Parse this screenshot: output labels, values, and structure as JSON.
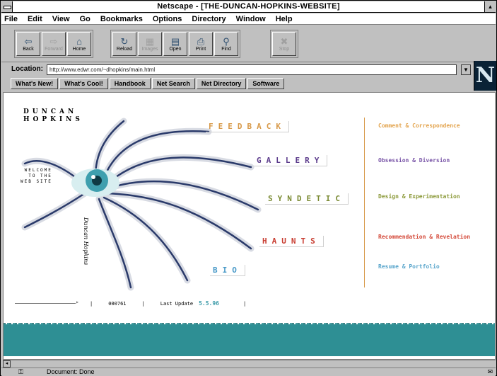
{
  "window": {
    "title": "Netscape - [THE-DUNCAN-HOPKINS-WEBSITE]",
    "maximize_glyph": "▴"
  },
  "menu": [
    "File",
    "Edit",
    "View",
    "Go",
    "Bookmarks",
    "Options",
    "Directory",
    "Window",
    "Help"
  ],
  "toolbar": {
    "nav_group": [
      {
        "label": "Back",
        "icon": "back-arrow-icon",
        "glyph": "⇦",
        "enabled": true
      },
      {
        "label": "Forward",
        "icon": "forward-arrow-icon",
        "glyph": "⇨",
        "enabled": false
      },
      {
        "label": "Home",
        "icon": "home-icon",
        "glyph": "⌂",
        "enabled": true
      }
    ],
    "load_group": [
      {
        "label": "Reload",
        "icon": "reload-icon",
        "glyph": "↻",
        "enabled": true
      },
      {
        "label": "Images",
        "icon": "images-icon",
        "glyph": "▦",
        "enabled": false
      },
      {
        "label": "Open",
        "icon": "open-icon",
        "glyph": "▤",
        "enabled": true
      },
      {
        "label": "Print",
        "icon": "print-icon",
        "glyph": "⎙",
        "enabled": true
      },
      {
        "label": "Find",
        "icon": "find-icon",
        "glyph": "⚲",
        "enabled": true
      }
    ],
    "stop_group": [
      {
        "label": "Stop",
        "icon": "stop-icon",
        "glyph": "✖",
        "enabled": false
      }
    ]
  },
  "location": {
    "label": "Location:",
    "url": "http://www.edwr.com/~dhopkins/main.html",
    "dropdown_glyph": "▼"
  },
  "directory_buttons": [
    "What's New!",
    "What's Cool!",
    "Handbook",
    "Net Search",
    "Net Directory",
    "Software"
  ],
  "logo_letter": "N",
  "page": {
    "brand": "DUNCAN\nHOPKINS",
    "welcome": "WELCOME\nTO THE\nWEB SITE",
    "signature": "Duncan Hopkins",
    "nav": [
      {
        "word": "FEEDBACK",
        "desc": "Comment & Correspondence",
        "color": "#d89a4a",
        "desc_color": "#e3a44e"
      },
      {
        "word": "GALLERY",
        "desc": "Obsession & Diversion",
        "color": "#5c3c8c",
        "desc_color": "#7a56a8"
      },
      {
        "word": "SYNDETIC",
        "desc": "Design & Experimentation",
        "color": "#7a8a32",
        "desc_color": "#8c9a3a"
      },
      {
        "word": "HAUNTS",
        "desc": "Recommendation & Revelation",
        "color": "#c83c30",
        "desc_color": "#d44a3a"
      },
      {
        "word": "BIO",
        "desc": "Resume & Portfolio",
        "color": "#4a9ac8",
        "desc_color": "#5aa6cc"
      }
    ],
    "footer": {
      "hits": "000761",
      "last_update_label": "Last Update",
      "last_update": "5.5.96"
    }
  },
  "status": {
    "text": "Document: Done",
    "key_glyph": "⚿",
    "mail_glyph": "✉"
  }
}
